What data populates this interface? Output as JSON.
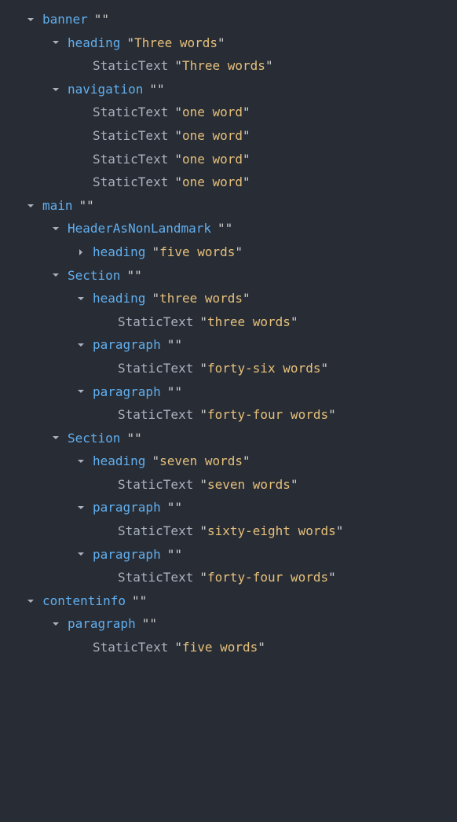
{
  "tree": [
    {
      "indent": 1,
      "arrow": "down",
      "roleClass": "role",
      "role": "banner",
      "text": "\"\""
    },
    {
      "indent": 2,
      "arrow": "down",
      "roleClass": "role",
      "role": "heading",
      "text": "\"Three words\""
    },
    {
      "indent": 3,
      "arrow": "none",
      "roleClass": "text-role",
      "role": "StaticText",
      "text": "\"Three words\""
    },
    {
      "indent": 2,
      "arrow": "down",
      "roleClass": "role",
      "role": "navigation",
      "text": "\"\""
    },
    {
      "indent": 3,
      "arrow": "none",
      "roleClass": "text-role",
      "role": "StaticText",
      "text": "\"one word\""
    },
    {
      "indent": 3,
      "arrow": "none",
      "roleClass": "text-role",
      "role": "StaticText",
      "text": "\"one word\""
    },
    {
      "indent": 3,
      "arrow": "none",
      "roleClass": "text-role",
      "role": "StaticText",
      "text": "\"one word\""
    },
    {
      "indent": 3,
      "arrow": "none",
      "roleClass": "text-role",
      "role": "StaticText",
      "text": "\"one word\""
    },
    {
      "indent": 1,
      "arrow": "down",
      "roleClass": "role",
      "role": "main",
      "text": "\"\""
    },
    {
      "indent": 2,
      "arrow": "down",
      "roleClass": "role",
      "role": "HeaderAsNonLandmark",
      "text": "\"\""
    },
    {
      "indent": 3,
      "arrow": "right",
      "roleClass": "role",
      "role": "heading",
      "text": "\"five words\""
    },
    {
      "indent": 2,
      "arrow": "down",
      "roleClass": "role",
      "role": "Section",
      "text": "\"\""
    },
    {
      "indent": 3,
      "arrow": "down",
      "roleClass": "role",
      "role": "heading",
      "text": "\"three words\""
    },
    {
      "indent": 4,
      "arrow": "none",
      "roleClass": "text-role",
      "role": "StaticText",
      "text": "\"three words\""
    },
    {
      "indent": 3,
      "arrow": "down",
      "roleClass": "role",
      "role": "paragraph",
      "text": "\"\""
    },
    {
      "indent": 4,
      "arrow": "none",
      "roleClass": "text-role",
      "role": "StaticText",
      "text": "\"forty-six words\""
    },
    {
      "indent": 3,
      "arrow": "down",
      "roleClass": "role",
      "role": "paragraph",
      "text": "\"\""
    },
    {
      "indent": 4,
      "arrow": "none",
      "roleClass": "text-role",
      "role": "StaticText",
      "text": "\"forty-four words\""
    },
    {
      "indent": 2,
      "arrow": "down",
      "roleClass": "role",
      "role": "Section",
      "text": "\"\""
    },
    {
      "indent": 3,
      "arrow": "down",
      "roleClass": "role",
      "role": "heading",
      "text": "\"seven words\""
    },
    {
      "indent": 4,
      "arrow": "none",
      "roleClass": "text-role",
      "role": "StaticText",
      "text": "\"seven words\""
    },
    {
      "indent": 3,
      "arrow": "down",
      "roleClass": "role",
      "role": "paragraph",
      "text": "\"\""
    },
    {
      "indent": 4,
      "arrow": "none",
      "roleClass": "text-role",
      "role": "StaticText",
      "text": "\"sixty-eight words\""
    },
    {
      "indent": 3,
      "arrow": "down",
      "roleClass": "role",
      "role": "paragraph",
      "text": "\"\""
    },
    {
      "indent": 4,
      "arrow": "none",
      "roleClass": "text-role",
      "role": "StaticText",
      "text": "\"forty-four words\""
    },
    {
      "indent": 1,
      "arrow": "down",
      "roleClass": "role",
      "role": "contentinfo",
      "text": "\"\""
    },
    {
      "indent": 2,
      "arrow": "down",
      "roleClass": "role",
      "role": "paragraph",
      "text": "\"\""
    },
    {
      "indent": 3,
      "arrow": "none",
      "roleClass": "text-role",
      "role": "StaticText",
      "text": "\"five words\""
    }
  ]
}
